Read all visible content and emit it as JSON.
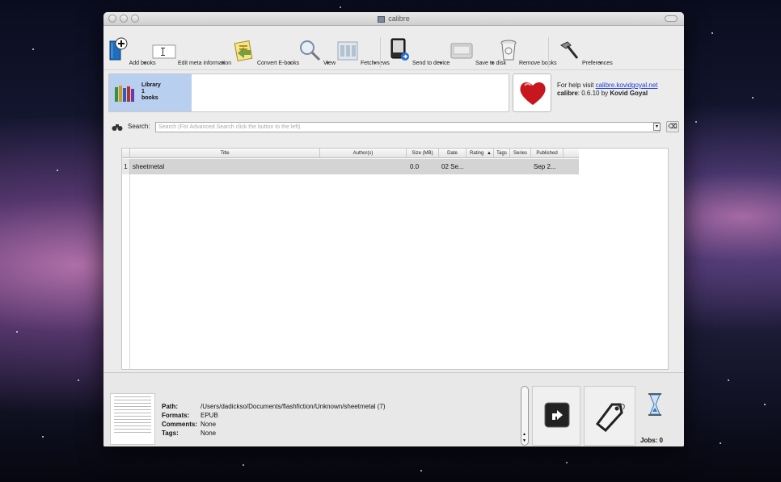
{
  "window": {
    "title": "calibre"
  },
  "toolbar": {
    "add_books": "Add books",
    "edit_meta": "Edit meta information",
    "convert": "Convert E-books",
    "view": "View",
    "fetch_news": "Fetch news",
    "send_to_device": "Send to device",
    "save_to_disk": "Save to disk",
    "remove_books": "Remove books",
    "preferences": "Preferences"
  },
  "library": {
    "line1": "Library",
    "line2": "1",
    "line3": "books"
  },
  "help": {
    "prefix": "For help visit ",
    "link": "calibre.kovidgoyal.net",
    "name": "calibre",
    "version_text": ": 0.6.10 by ",
    "author": "Kovid Goyal"
  },
  "search": {
    "label": "Search:",
    "placeholder": "Search (For Advanced Search click the button to the left)"
  },
  "table": {
    "columns": [
      "Title",
      "Author(s)",
      "Size (MB)",
      "Date",
      "Rating",
      "Tags",
      "Series",
      "Published"
    ],
    "rows": [
      {
        "num": "1",
        "title": "sheetmetal",
        "authors": "",
        "size": "0.0",
        "date": "02 Se...",
        "rating": "",
        "tags": "",
        "series": "",
        "published": "Sep 2..."
      }
    ]
  },
  "details": {
    "path_label": "Path:",
    "path": "/Users/dadickso/Documents/flashfiction/Unknown/sheetmetal (7)",
    "formats_label": "Formats:",
    "formats": "EPUB",
    "comments_label": "Comments:",
    "comments": "None",
    "tags_label": "Tags:",
    "tags": "None"
  },
  "jobs": {
    "label": "Jobs: 0"
  },
  "colors": {
    "selection": "#b9cfef",
    "link": "#1a3fd0",
    "heart": "#c8161e"
  }
}
